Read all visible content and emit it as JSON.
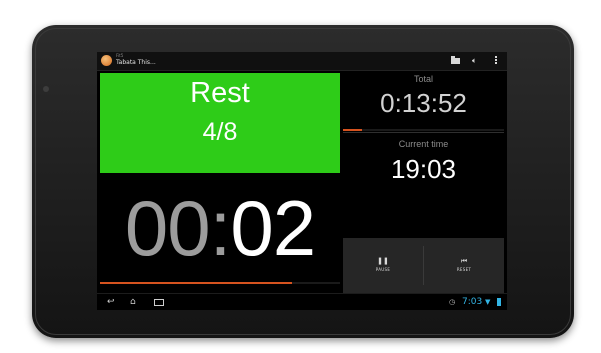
{
  "app": {
    "subtitle": "Fit5",
    "title": "Tabata This..."
  },
  "action_icons": [
    "folder-icon",
    "volume-icon",
    "overflow-menu-icon"
  ],
  "interval": {
    "phase": "Rest",
    "round": "4/8",
    "countdown_minutes": "00",
    "countdown_separator": ":",
    "countdown_seconds": "02",
    "interval_progress": 0.8,
    "color": "#2ecc18"
  },
  "total": {
    "label": "Total",
    "value": "0:13:52",
    "progress": 0.12
  },
  "current_time": {
    "label": "Current time",
    "value": "19:03"
  },
  "controls": {
    "pause": {
      "icon": "pause-icon",
      "label": "PAUSE"
    },
    "reset": {
      "icon": "skip-previous-icon",
      "label": "RESET"
    }
  },
  "system_bar": {
    "time": "7:03",
    "accent": "#33b5e5",
    "progress_color": "#d6531f"
  }
}
